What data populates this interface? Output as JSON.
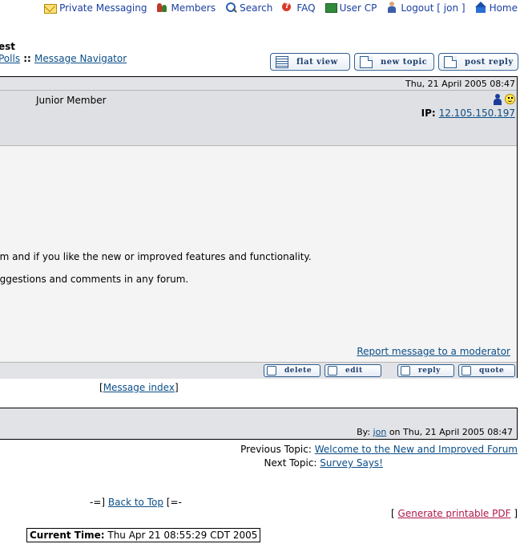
{
  "nav": {
    "private_messaging": "Private Messaging",
    "members": "Members",
    "search": "Search",
    "faq": "FAQ",
    "user_cp": "User CP",
    "logout": "Logout [ jon ]",
    "home": "Home"
  },
  "header": {
    "title_fragment": "est",
    "breadcrumb_polls": "Polls",
    "breadcrumb_sep": " :: ",
    "breadcrumb_navigator": "Message Navigator"
  },
  "toolbar": {
    "flat_view": "flat view",
    "new_topic": "new topic",
    "post_reply": "post reply"
  },
  "post": {
    "date": "Thu, 21 April 2005 08:47",
    "rank": "Junior Member",
    "ip_label": "IP:",
    "ip_value": "12.105.150.197",
    "line1": "um and if you like the new or improved features and functionality.",
    "line2": "uggestions and comments in any forum.",
    "report": "Report message to a moderator",
    "actions": {
      "delete": "delete",
      "edit": "edit",
      "reply": "reply",
      "quote": "quote"
    }
  },
  "message_index": {
    "open": "[",
    "label": "Message index",
    "close": "]"
  },
  "lower": {
    "by_label": "By:",
    "by_user": "jon",
    "on_date": "on Thu, 21 April 2005 08:47"
  },
  "topics": {
    "previous_label": "Previous Topic:",
    "previous_link": "Welcome to the New and Improved Forum",
    "next_label": "Next Topic:",
    "next_link": "Survey Says!"
  },
  "footer": {
    "back_prefix": "-=]",
    "back_to_top": "Back to Top",
    "back_suffix": "[=-",
    "pdf_open": "[",
    "pdf_label": "Generate printable PDF",
    "pdf_close": "]",
    "current_time_label": "Current Time:",
    "current_time_value": "Thu Apr 21 08:55:29 CDT 2005"
  }
}
